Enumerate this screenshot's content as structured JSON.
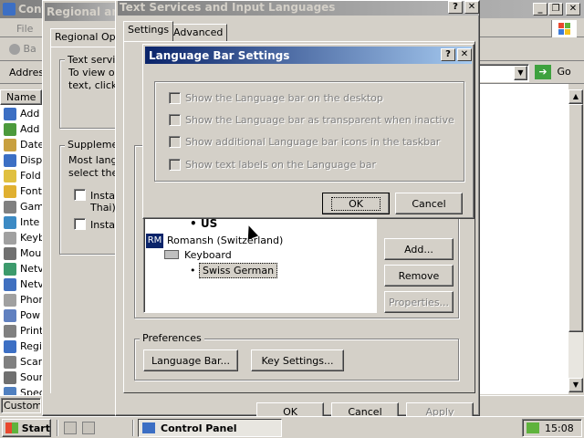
{
  "colors": {
    "desktop": "#3a6ea5",
    "title_active": "#0a246a",
    "title_inactive": "#808080"
  },
  "control_panel": {
    "title": "Cont",
    "menu_file": "File",
    "back_label": "Ba",
    "address_label": "Addres",
    "column_name": "Name",
    "items": [
      "Add",
      "Add",
      "Date",
      "Disp",
      "Fold",
      "Font",
      "Gam",
      "Inte",
      "Keyb",
      "Mou",
      "Netv",
      "Netv",
      "Phor",
      "Pow",
      "Print",
      "Regi",
      "Scar",
      "Sour",
      "Spec"
    ],
    "status": "Customiz",
    "go_label": "Go"
  },
  "regional": {
    "title": "Regional and",
    "tab": "Regional Opt",
    "text_services_group": "Text servic",
    "text_services_body": "To view o\ntext, click",
    "supplemental_group": "Suppleme",
    "supplemental_body": "Most langu\nselect the",
    "chk1": "Insta",
    "chk1_extra": "Thai)",
    "chk2": "Insta"
  },
  "text_services": {
    "title": "Text Services and Input Languages",
    "tabs": [
      "Settings",
      "Advanced"
    ],
    "lang_us": "US",
    "lang_name": "Romansh (Switzerland)",
    "lang_badge": "RM",
    "keyboard_label": "Keyboard",
    "layout_selected": "Swiss German",
    "add_btn": "Add...",
    "remove_btn": "Remove",
    "properties_btn": "Properties...",
    "preferences_group": "Preferences",
    "language_bar_btn": "Language Bar...",
    "key_settings_btn": "Key Settings...",
    "ok_btn": "OK",
    "cancel_btn": "Cancel",
    "apply_btn": "Apply"
  },
  "language_bar": {
    "title": "Language Bar Settings",
    "options": [
      "Show the Language bar on the desktop",
      "Show the Language bar as transparent when inactive",
      "Show additional Language bar icons in the taskbar",
      "Show text labels on the Language bar"
    ],
    "ok_btn": "OK",
    "cancel_btn": "Cancel"
  },
  "taskbar": {
    "start": "Start",
    "task": "Control Panel",
    "clock": "15:08"
  }
}
